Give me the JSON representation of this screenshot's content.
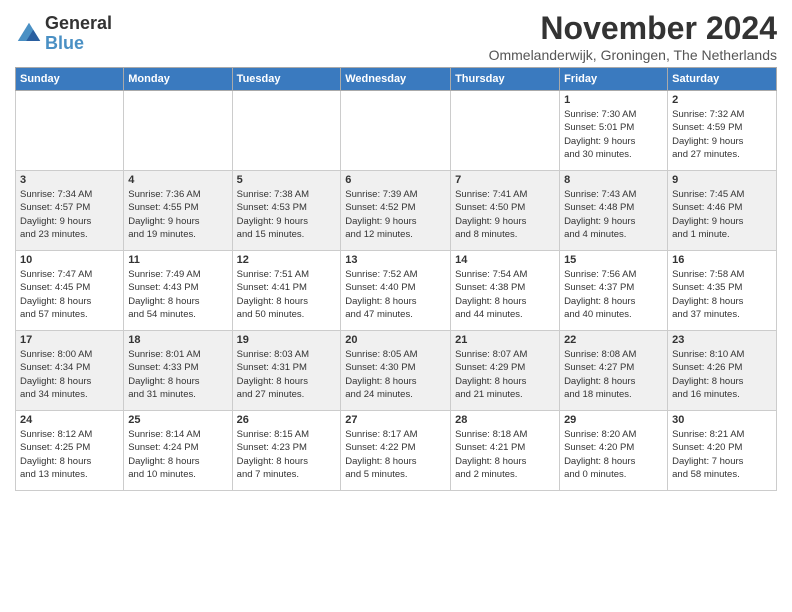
{
  "header": {
    "logo_line1": "General",
    "logo_line2": "Blue",
    "title": "November 2024",
    "subtitle": "Ommelanderwijk, Groningen, The Netherlands"
  },
  "weekdays": [
    "Sunday",
    "Monday",
    "Tuesday",
    "Wednesday",
    "Thursday",
    "Friday",
    "Saturday"
  ],
  "weeks": [
    [
      {
        "day": "",
        "info": ""
      },
      {
        "day": "",
        "info": ""
      },
      {
        "day": "",
        "info": ""
      },
      {
        "day": "",
        "info": ""
      },
      {
        "day": "",
        "info": ""
      },
      {
        "day": "1",
        "info": "Sunrise: 7:30 AM\nSunset: 5:01 PM\nDaylight: 9 hours\nand 30 minutes."
      },
      {
        "day": "2",
        "info": "Sunrise: 7:32 AM\nSunset: 4:59 PM\nDaylight: 9 hours\nand 27 minutes."
      }
    ],
    [
      {
        "day": "3",
        "info": "Sunrise: 7:34 AM\nSunset: 4:57 PM\nDaylight: 9 hours\nand 23 minutes."
      },
      {
        "day": "4",
        "info": "Sunrise: 7:36 AM\nSunset: 4:55 PM\nDaylight: 9 hours\nand 19 minutes."
      },
      {
        "day": "5",
        "info": "Sunrise: 7:38 AM\nSunset: 4:53 PM\nDaylight: 9 hours\nand 15 minutes."
      },
      {
        "day": "6",
        "info": "Sunrise: 7:39 AM\nSunset: 4:52 PM\nDaylight: 9 hours\nand 12 minutes."
      },
      {
        "day": "7",
        "info": "Sunrise: 7:41 AM\nSunset: 4:50 PM\nDaylight: 9 hours\nand 8 minutes."
      },
      {
        "day": "8",
        "info": "Sunrise: 7:43 AM\nSunset: 4:48 PM\nDaylight: 9 hours\nand 4 minutes."
      },
      {
        "day": "9",
        "info": "Sunrise: 7:45 AM\nSunset: 4:46 PM\nDaylight: 9 hours\nand 1 minute."
      }
    ],
    [
      {
        "day": "10",
        "info": "Sunrise: 7:47 AM\nSunset: 4:45 PM\nDaylight: 8 hours\nand 57 minutes."
      },
      {
        "day": "11",
        "info": "Sunrise: 7:49 AM\nSunset: 4:43 PM\nDaylight: 8 hours\nand 54 minutes."
      },
      {
        "day": "12",
        "info": "Sunrise: 7:51 AM\nSunset: 4:41 PM\nDaylight: 8 hours\nand 50 minutes."
      },
      {
        "day": "13",
        "info": "Sunrise: 7:52 AM\nSunset: 4:40 PM\nDaylight: 8 hours\nand 47 minutes."
      },
      {
        "day": "14",
        "info": "Sunrise: 7:54 AM\nSunset: 4:38 PM\nDaylight: 8 hours\nand 44 minutes."
      },
      {
        "day": "15",
        "info": "Sunrise: 7:56 AM\nSunset: 4:37 PM\nDaylight: 8 hours\nand 40 minutes."
      },
      {
        "day": "16",
        "info": "Sunrise: 7:58 AM\nSunset: 4:35 PM\nDaylight: 8 hours\nand 37 minutes."
      }
    ],
    [
      {
        "day": "17",
        "info": "Sunrise: 8:00 AM\nSunset: 4:34 PM\nDaylight: 8 hours\nand 34 minutes."
      },
      {
        "day": "18",
        "info": "Sunrise: 8:01 AM\nSunset: 4:33 PM\nDaylight: 8 hours\nand 31 minutes."
      },
      {
        "day": "19",
        "info": "Sunrise: 8:03 AM\nSunset: 4:31 PM\nDaylight: 8 hours\nand 27 minutes."
      },
      {
        "day": "20",
        "info": "Sunrise: 8:05 AM\nSunset: 4:30 PM\nDaylight: 8 hours\nand 24 minutes."
      },
      {
        "day": "21",
        "info": "Sunrise: 8:07 AM\nSunset: 4:29 PM\nDaylight: 8 hours\nand 21 minutes."
      },
      {
        "day": "22",
        "info": "Sunrise: 8:08 AM\nSunset: 4:27 PM\nDaylight: 8 hours\nand 18 minutes."
      },
      {
        "day": "23",
        "info": "Sunrise: 8:10 AM\nSunset: 4:26 PM\nDaylight: 8 hours\nand 16 minutes."
      }
    ],
    [
      {
        "day": "24",
        "info": "Sunrise: 8:12 AM\nSunset: 4:25 PM\nDaylight: 8 hours\nand 13 minutes."
      },
      {
        "day": "25",
        "info": "Sunrise: 8:14 AM\nSunset: 4:24 PM\nDaylight: 8 hours\nand 10 minutes."
      },
      {
        "day": "26",
        "info": "Sunrise: 8:15 AM\nSunset: 4:23 PM\nDaylight: 8 hours\nand 7 minutes."
      },
      {
        "day": "27",
        "info": "Sunrise: 8:17 AM\nSunset: 4:22 PM\nDaylight: 8 hours\nand 5 minutes."
      },
      {
        "day": "28",
        "info": "Sunrise: 8:18 AM\nSunset: 4:21 PM\nDaylight: 8 hours\nand 2 minutes."
      },
      {
        "day": "29",
        "info": "Sunrise: 8:20 AM\nSunset: 4:20 PM\nDaylight: 8 hours\nand 0 minutes."
      },
      {
        "day": "30",
        "info": "Sunrise: 8:21 AM\nSunset: 4:20 PM\nDaylight: 7 hours\nand 58 minutes."
      }
    ]
  ]
}
